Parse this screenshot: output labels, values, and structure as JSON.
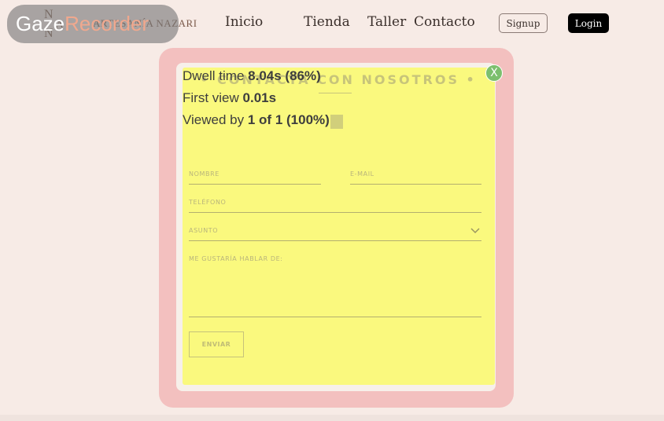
{
  "header": {
    "logo_letters": [
      "N",
      "A",
      "N"
    ],
    "logo_text": "ARTESANÍA NAZARI",
    "nav": [
      "Inicio",
      "Tienda",
      "Taller",
      "Contacto"
    ],
    "signup_label": "Signup",
    "login_label": "Login"
  },
  "overlay_badge": {
    "part1": "Gaze",
    "part2": "Recorder"
  },
  "form": {
    "title": "• CONTACTA CON NOSOTROS •",
    "fields": {
      "nombre": "NOMBRE",
      "email": "E-MAIL",
      "telefono": "TELÉFONO",
      "asunto": "ASUNTO",
      "mensaje": "ME GUSTARÍA HABLAR DE:"
    },
    "submit_label": "ENVIAR"
  },
  "stats": {
    "dwell_label": "Dwell time",
    "dwell_value": "8.04s (86%)",
    "first_label": "First view",
    "first_value": "0.01s",
    "viewed_label": "Viewed by",
    "viewed_value": "1 of 1 (100%)"
  },
  "close_label": "X",
  "colors": {
    "background": "#f7ebe6",
    "modal_frame": "#f3c0bf",
    "heatmap": "#faf97e",
    "close_button": "#7cbf6e"
  }
}
